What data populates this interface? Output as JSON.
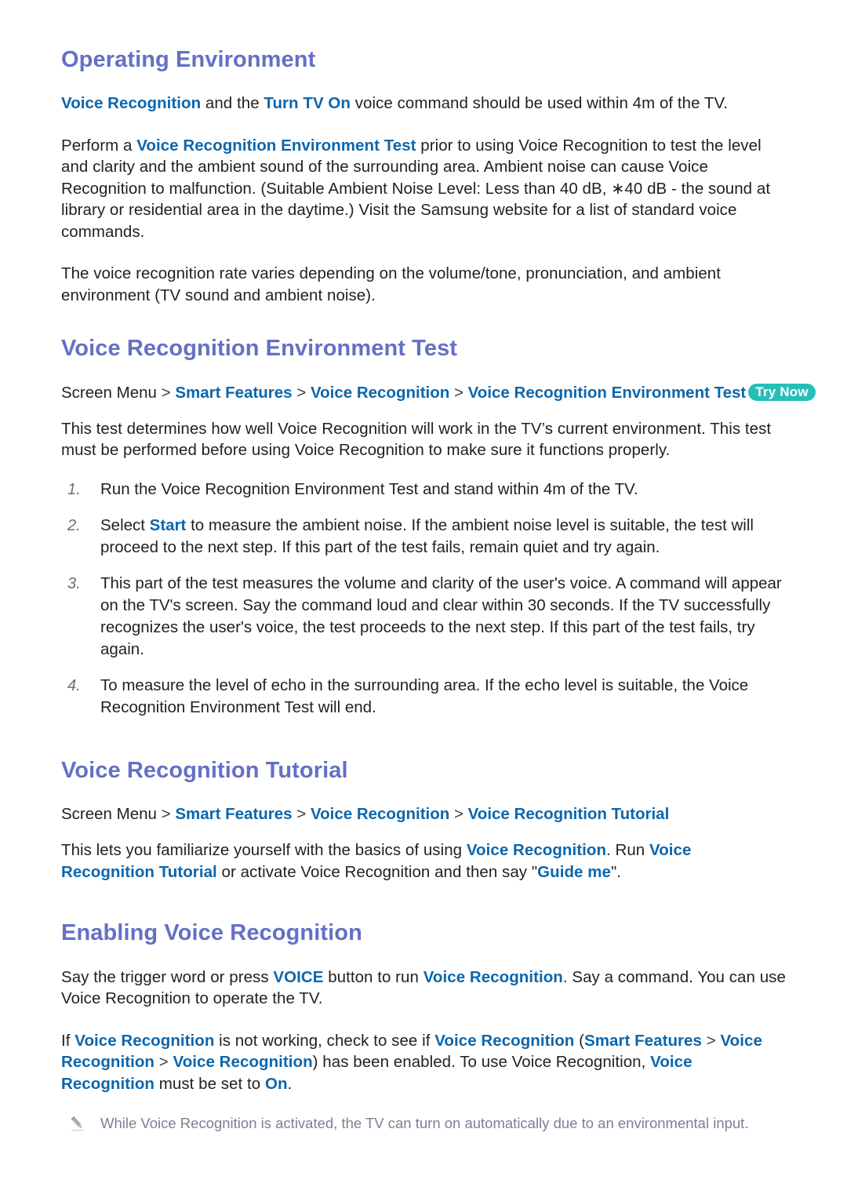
{
  "document": {
    "type": "e-manual-page",
    "accent_heading_color": "#6370c6",
    "accent_link_color": "#0c66ac",
    "badge_color": "#25bfb8",
    "body_color": "#231f20",
    "note_color": "#7b7f93"
  },
  "sections": [
    {
      "id": "operating-environment",
      "title": "Operating Environment",
      "paragraphs": [
        {
          "id": "oe-p1",
          "runs": [
            {
              "t": "hl",
              "s": "Voice Recognition"
            },
            {
              "t": "n",
              "s": " and the "
            },
            {
              "t": "hl",
              "s": "Turn TV On"
            },
            {
              "t": "n",
              "s": " voice command should be used within 4m of the TV."
            }
          ]
        },
        {
          "id": "oe-p2",
          "runs": [
            {
              "t": "n",
              "s": "Perform a "
            },
            {
              "t": "hl",
              "s": "Voice Recognition Environment Test"
            },
            {
              "t": "n",
              "s": " prior to using Voice Recognition to test the level and clarity and the ambient sound of the surrounding area. Ambient noise can cause Voice Recognition to malfunction. (Suitable Ambient Noise Level: Less than 40 dB, ∗40 dB - the sound at library or residential area in the daytime.) Visit the Samsung website for a list of standard voice commands."
            }
          ]
        },
        {
          "id": "oe-p3",
          "runs": [
            {
              "t": "n",
              "s": "The voice recognition rate varies depending on the volume/tone, pronunciation, and ambient environment (TV sound and ambient noise)."
            }
          ]
        }
      ]
    },
    {
      "id": "voice-recognition-environment-test",
      "title": "Voice Recognition Environment Test",
      "breadcrumb": {
        "root": "Screen Menu",
        "separator": ">",
        "items": [
          "Smart Features",
          "Voice Recognition",
          "Voice Recognition Environment Test"
        ],
        "badge": "Try Now"
      },
      "paragraphs": [
        {
          "id": "vret-p1",
          "runs": [
            {
              "t": "n",
              "s": "This test determines how well Voice Recognition will work in the TV’s current environment. This test must be performed before using Voice Recognition to make sure it functions properly."
            }
          ]
        }
      ],
      "steps": [
        {
          "num": "1.",
          "runs": [
            {
              "t": "n",
              "s": "Run the Voice Recognition Environment Test and stand within 4m of the TV."
            }
          ]
        },
        {
          "num": "2.",
          "runs": [
            {
              "t": "n",
              "s": "Select "
            },
            {
              "t": "hl",
              "s": "Start"
            },
            {
              "t": "n",
              "s": " to measure the ambient noise. If the ambient noise level is suitable, the test will proceed to the next step. If this part of the test fails, remain quiet and try again."
            }
          ]
        },
        {
          "num": "3.",
          "runs": [
            {
              "t": "n",
              "s": "This part of the test measures the volume and clarity of the user's voice. A command will appear on the TV's screen. Say the command loud and clear within 30 seconds. If the TV successfully recognizes the user's voice, the test proceeds to the next step. If this part of the test fails, try again."
            }
          ]
        },
        {
          "num": "4.",
          "runs": [
            {
              "t": "n",
              "s": "To measure the level of echo in the surrounding area. If the echo level is suitable, the Voice Recognition Environment Test will end."
            }
          ]
        }
      ]
    },
    {
      "id": "voice-recognition-tutorial",
      "title": "Voice Recognition Tutorial",
      "breadcrumb": {
        "root": "Screen Menu",
        "separator": ">",
        "items": [
          "Smart Features",
          "Voice Recognition",
          "Voice Recognition Tutorial"
        ],
        "badge": ""
      },
      "paragraphs": [
        {
          "id": "vrt-p1",
          "runs": [
            {
              "t": "n",
              "s": "This lets you familiarize yourself with the basics of using "
            },
            {
              "t": "hl",
              "s": "Voice Recognition"
            },
            {
              "t": "n",
              "s": ". Run "
            },
            {
              "t": "hl",
              "s": "Voice Recognition Tutorial"
            },
            {
              "t": "n",
              "s": " or activate Voice Recognition and then say \""
            },
            {
              "t": "hl",
              "s": "Guide me"
            },
            {
              "t": "n",
              "s": "\"."
            }
          ]
        }
      ]
    },
    {
      "id": "enabling-voice-recognition",
      "title": "Enabling Voice Recognition",
      "paragraphs": [
        {
          "id": "evr-p1",
          "runs": [
            {
              "t": "n",
              "s": "Say the trigger word or press "
            },
            {
              "t": "hl",
              "s": "VOICE"
            },
            {
              "t": "n",
              "s": " button to run "
            },
            {
              "t": "hl",
              "s": "Voice Recognition"
            },
            {
              "t": "n",
              "s": ". Say a command. You can use Voice Recognition to operate the TV."
            }
          ]
        },
        {
          "id": "evr-p2",
          "runs": [
            {
              "t": "n",
              "s": "If "
            },
            {
              "t": "hl",
              "s": "Voice Recognition"
            },
            {
              "t": "n",
              "s": " is not working, check to see if "
            },
            {
              "t": "hl",
              "s": "Voice Recognition"
            },
            {
              "t": "n",
              "s": " ("
            },
            {
              "t": "hl",
              "s": "Smart Features"
            },
            {
              "t": "sep",
              "s": " > "
            },
            {
              "t": "hl",
              "s": "Voice Recognition"
            },
            {
              "t": "sep",
              "s": " > "
            },
            {
              "t": "hl",
              "s": "Voice Recognition"
            },
            {
              "t": "n",
              "s": ") has been enabled. To use Voice Recognition, "
            },
            {
              "t": "hl",
              "s": "Voice Recognition"
            },
            {
              "t": "n",
              "s": " must be set to "
            },
            {
              "t": "hl",
              "s": "On"
            },
            {
              "t": "n",
              "s": "."
            }
          ]
        }
      ],
      "note": {
        "icon": "pencil-icon",
        "text": "While Voice Recognition is activated, the TV can turn on automatically due to an environmental input."
      }
    }
  ]
}
